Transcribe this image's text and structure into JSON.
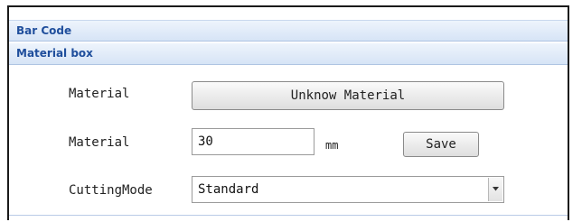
{
  "sections": {
    "barcode_title": "Bar Code",
    "material_box_title": "Material box"
  },
  "material_box": {
    "material_label": "Material",
    "material_button": "Unknow Material",
    "length_label": "Material",
    "length_value": "30",
    "length_unit": "mm",
    "save_button": "Save",
    "cutting_mode_label": "CuttingMode",
    "cutting_mode_value": "Standard"
  },
  "icons": {
    "dropdown": "chevron-down-icon"
  }
}
